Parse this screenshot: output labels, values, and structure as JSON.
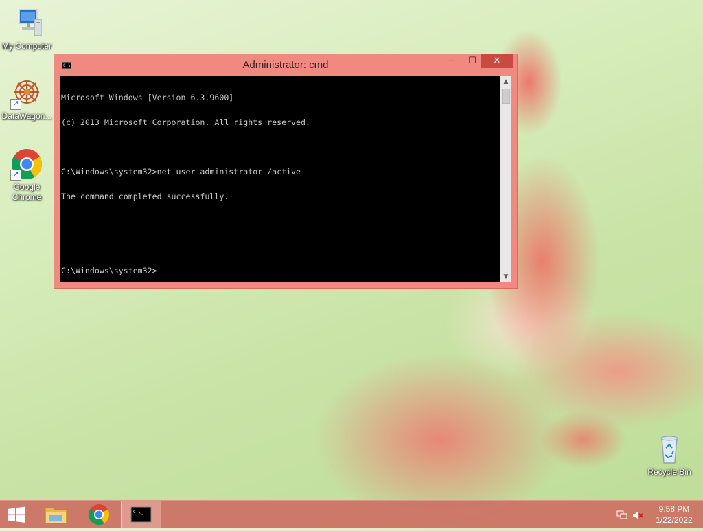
{
  "desktop": {
    "icons": [
      {
        "label": "My Computer",
        "icon": "computer-icon"
      },
      {
        "label": "DataWagon...",
        "icon": "datawagon-icon"
      },
      {
        "label": "Google Chrome",
        "icon": "chrome-icon"
      },
      {
        "label": "Recycle Bin",
        "icon": "recycle-bin-icon"
      }
    ]
  },
  "cmd": {
    "title": "Administrator: cmd",
    "icon_text": "C:\\",
    "controls": {
      "minimize": "─",
      "maximize": "☐",
      "close": "✕"
    },
    "lines": [
      "Microsoft Windows [Version 6.3.9600]",
      "(c) 2013 Microsoft Corporation. All rights reserved.",
      "",
      "C:\\Windows\\system32>net user administrator /active",
      "The command completed successfully.",
      "",
      "",
      "C:\\Windows\\system32>"
    ],
    "text_color": "#c8c8c8",
    "background_color": "#000000",
    "frame_color": "#f08a80"
  },
  "taskbar": {
    "items": [
      "start-button",
      "file-explorer",
      "google-chrome",
      "command-prompt"
    ],
    "clock": {
      "time": "9:58 PM",
      "date": "1/22/2022"
    },
    "color": "#cd7064"
  }
}
